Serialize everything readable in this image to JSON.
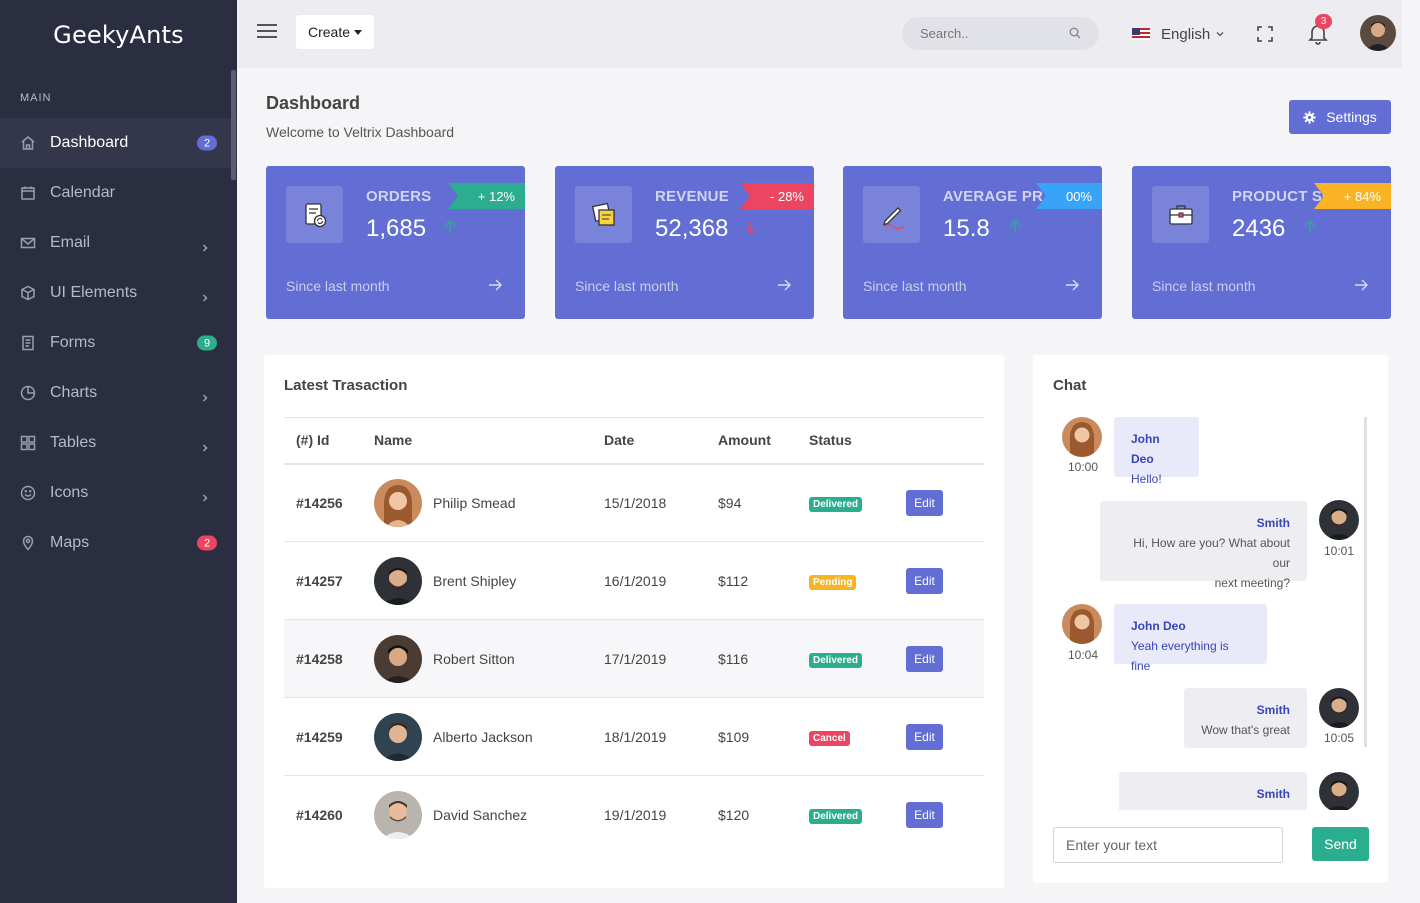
{
  "brand": "GeekyAnts",
  "sidebar": {
    "section_title": "MAIN",
    "items": [
      {
        "label": "Dashboard",
        "icon": "home-icon",
        "badge": "2",
        "badge_color": "#626ed4",
        "active": true
      },
      {
        "label": "Calendar",
        "icon": "calendar-icon"
      },
      {
        "label": "Email",
        "icon": "mail-icon",
        "chevron": true
      },
      {
        "label": "UI Elements",
        "icon": "cube-icon",
        "chevron": true
      },
      {
        "label": "Forms",
        "icon": "form-icon",
        "badge": "9",
        "badge_color": "#2bae8f"
      },
      {
        "label": "Charts",
        "icon": "pie-chart-icon",
        "chevron": true
      },
      {
        "label": "Tables",
        "icon": "grid-icon",
        "chevron": true
      },
      {
        "label": "Icons",
        "icon": "smile-icon",
        "chevron": true
      },
      {
        "label": "Maps",
        "icon": "map-pin-icon",
        "badge": "2",
        "badge_color": "#ec4561"
      }
    ]
  },
  "topbar": {
    "create_label": "Create",
    "search_placeholder": "Search..",
    "language": "English",
    "notification_count": "3"
  },
  "page": {
    "title": "Dashboard",
    "subtitle": "Welcome to Veltrix Dashboard",
    "settings_label": "Settings"
  },
  "stats": [
    {
      "label": "ORDERS",
      "value": "1,685",
      "change": "+ 12%",
      "trend": "up",
      "ribbon_color": "#2bae8f",
      "since": "Since last month"
    },
    {
      "label": "REVENUE",
      "value": "52,368",
      "change": "- 28%",
      "trend": "down",
      "ribbon_color": "#ec4561",
      "since": "Since last month"
    },
    {
      "label": "AVERAGE PRICE",
      "value": "15.8",
      "change": "00%",
      "trend": "up",
      "ribbon_color": "#38a4f8",
      "since": "Since last month"
    },
    {
      "label": "PRODUCT SOLD",
      "value": "2436",
      "change": "+ 84%",
      "trend": "up",
      "ribbon_color": "#f8b425",
      "since": "Since last month"
    }
  ],
  "transactions": {
    "title": "Latest Trasaction",
    "columns": [
      "(#) Id",
      "Name",
      "Date",
      "Amount",
      "Status"
    ],
    "rows": [
      {
        "id": "#14256",
        "name": "Philip Smead",
        "date": "15/1/2018",
        "amount": "$94",
        "status": "Delivered",
        "status_color": "#2bae8f"
      },
      {
        "id": "#14257",
        "name": "Brent Shipley",
        "date": "16/1/2019",
        "amount": "$112",
        "status": "Pending",
        "status_color": "#f8b425"
      },
      {
        "id": "#14258",
        "name": "Robert Sitton",
        "date": "17/1/2019",
        "amount": "$116",
        "status": "Delivered",
        "status_color": "#2bae8f"
      },
      {
        "id": "#14259",
        "name": "Alberto Jackson",
        "date": "18/1/2019",
        "amount": "$109",
        "status": "Cancel",
        "status_color": "#ec4561"
      },
      {
        "id": "#14260",
        "name": "David Sanchez",
        "date": "19/1/2019",
        "amount": "$120",
        "status": "Delivered",
        "status_color": "#2bae8f"
      }
    ],
    "edit_label": "Edit"
  },
  "chat": {
    "title": "Chat",
    "messages": [
      {
        "who": "John Deo",
        "text": "Hello!",
        "time": "10:00",
        "side": "left"
      },
      {
        "who": "Smith",
        "text_lines": [
          "Hi, How are you? What about our",
          "next meeting?"
        ],
        "time": "10:01",
        "side": "right"
      },
      {
        "who": "John Deo",
        "text": "Yeah everything is fine",
        "time": "10:04",
        "side": "left"
      },
      {
        "who": "Smith",
        "text": "Wow that's great",
        "time": "10:05",
        "side": "right"
      },
      {
        "who": "Smith",
        "text": "",
        "time": "",
        "side": "right"
      }
    ],
    "input_placeholder": "Enter your text",
    "send_label": "Send"
  }
}
